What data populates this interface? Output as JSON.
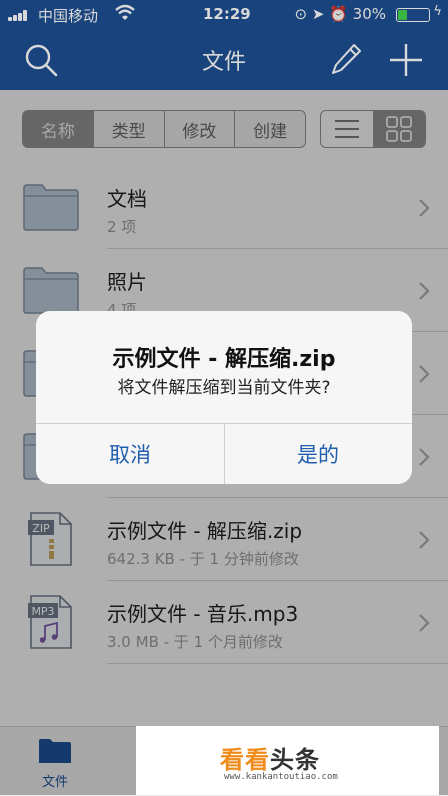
{
  "status_bar": {
    "carrier": "中国移动",
    "time": "12:29",
    "battery_percent": "30%",
    "battery_level": 0.3,
    "icons": [
      "signal-icon",
      "wifi-icon",
      "lock-rotation-icon",
      "location-icon",
      "alarm-icon",
      "battery-icon",
      "charging-icon"
    ]
  },
  "nav": {
    "title": "文件",
    "left_icon": "search-icon",
    "right_icons": [
      "edit-pencil-icon",
      "add-plus-icon"
    ]
  },
  "sort_tabs": [
    {
      "label": "名称",
      "selected": true
    },
    {
      "label": "类型",
      "selected": false
    },
    {
      "label": "修改",
      "selected": false
    },
    {
      "label": "创建",
      "selected": false
    }
  ],
  "view_toggle": {
    "options": [
      "list-view-icon",
      "grid-view-icon"
    ],
    "selected": "grid-view-icon"
  },
  "files": [
    {
      "name": "文档",
      "sub": "2 项",
      "icon": "folder-icon"
    },
    {
      "name": "照片",
      "sub": "4 项",
      "icon": "folder-icon"
    },
    {
      "name": "",
      "sub": "",
      "icon": "folder-icon"
    },
    {
      "name": "",
      "sub": "",
      "icon": "folder-icon"
    },
    {
      "name": "示例文件 - 解压缩.zip",
      "sub": "642.3 KB - 于 1 分钟前修改",
      "icon": "zip-file-icon",
      "badge": "ZIP"
    },
    {
      "name": "示例文件 - 音乐.mp3",
      "sub": "3.0 MB - 于 1 个月前修改",
      "icon": "mp3-file-icon",
      "badge": "MP3"
    }
  ],
  "dialog": {
    "title": "示例文件 - 解压缩.zip",
    "message": "将文件解压缩到当前文件夹?",
    "cancel_label": "取消",
    "confirm_label": "是的"
  },
  "tab_bar": {
    "label": "文件",
    "icon": "folder-tab-icon"
  },
  "watermark": {
    "brand_a": "看看",
    "brand_b": "头条",
    "url": "www.kankantoutiao.com"
  },
  "colors": {
    "nav_blue": "#1d4f93",
    "accent_blue": "#1f5fae",
    "battery_green": "#44d44a",
    "watermark_orange": "#f08c1c"
  }
}
